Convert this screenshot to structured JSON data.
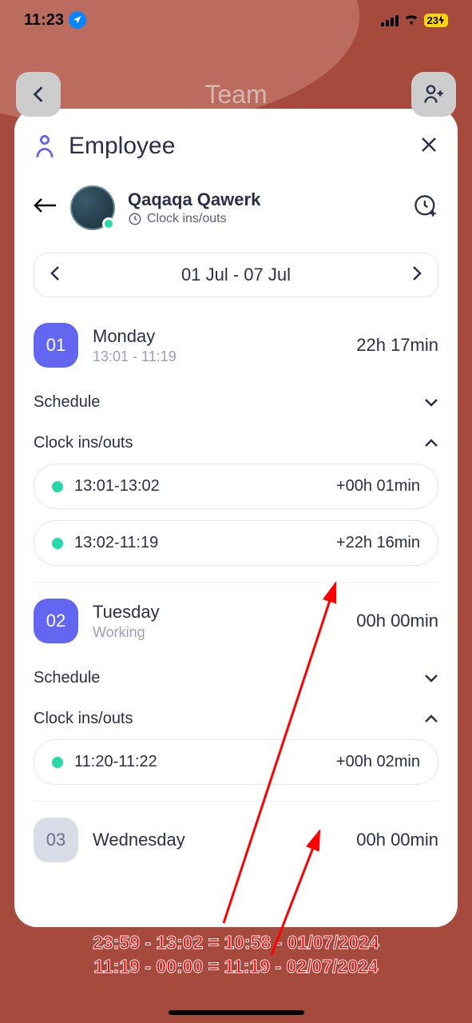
{
  "status": {
    "time": "11:23",
    "battery": "23"
  },
  "nav": {
    "title": "Team"
  },
  "modal": {
    "title": "Employee"
  },
  "employee": {
    "name": "Qaqaqa Qawerk",
    "subtitle": "Clock ins/outs"
  },
  "dateRange": "01 Jul - 07 Jul",
  "sections": {
    "schedule": "Schedule",
    "clock": "Clock ins/outs"
  },
  "days": [
    {
      "num": "01",
      "name": "Monday",
      "sub": "13:01 - 11:19",
      "total": "22h 17min",
      "punches": [
        {
          "time": "13:01-13:02",
          "dur": "+00h 01min"
        },
        {
          "time": "13:02-11:19",
          "dur": "+22h 16min"
        }
      ]
    },
    {
      "num": "02",
      "name": "Tuesday",
      "sub": "Working",
      "total": "00h 00min",
      "punches": [
        {
          "time": "11:20-11:22",
          "dur": "+00h 02min"
        }
      ]
    },
    {
      "num": "03",
      "name": "Wednesday",
      "sub": "",
      "total": "00h 00min"
    }
  ],
  "annotation": {
    "line1": "23:59 - 13:02 = 10:58 - 01/07/2024",
    "line2": "11:19 - 00:00 = 11:19 - 02/07/2024"
  }
}
